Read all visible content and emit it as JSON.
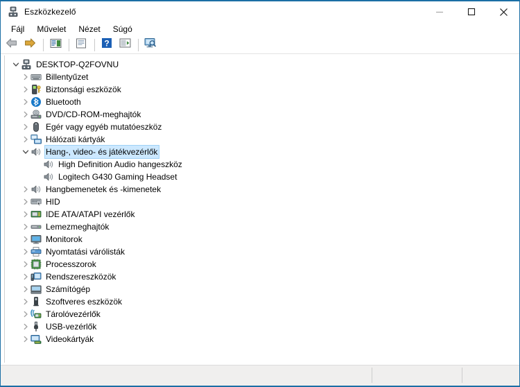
{
  "window": {
    "title": "Eszközkezelő",
    "app_icon": "device-manager-icon",
    "controls": {
      "minimize": "minimize-icon",
      "maximize": "maximize-icon",
      "close": "close-icon"
    }
  },
  "menubar": {
    "items": [
      {
        "label": "Fájl",
        "name": "menu-file"
      },
      {
        "label": "Művelet",
        "name": "menu-action"
      },
      {
        "label": "Nézet",
        "name": "menu-view"
      },
      {
        "label": "Súgó",
        "name": "menu-help"
      }
    ]
  },
  "toolbar": {
    "buttons": [
      {
        "name": "back-button",
        "icon": "left-arrow-icon"
      },
      {
        "name": "forward-button",
        "icon": "right-arrow-icon"
      },
      {
        "name": "properties-button",
        "icon": "properties-icon"
      },
      {
        "name": "update-driver-button",
        "icon": "document-icon"
      },
      {
        "name": "help-button",
        "icon": "question-mark-icon"
      },
      {
        "name": "scan-hardware-button",
        "icon": "scan-icon"
      },
      {
        "name": "show-hidden-devices-button",
        "icon": "monitor-search-icon"
      }
    ]
  },
  "tree": {
    "root": {
      "label": "DESKTOP-Q2FOVNU",
      "icon": "computer-icon",
      "expanded": true,
      "depth": 0
    },
    "nodes": [
      {
        "label": "Billentyűzet",
        "icon": "keyboard-icon",
        "depth": 1,
        "expanded": false,
        "selected": false
      },
      {
        "label": "Biztonsági eszközök",
        "icon": "security-device-icon",
        "depth": 1,
        "expanded": false,
        "selected": false
      },
      {
        "label": "Bluetooth",
        "icon": "bluetooth-icon",
        "depth": 1,
        "expanded": false,
        "selected": false
      },
      {
        "label": "DVD/CD-ROM-meghajtók",
        "icon": "dvd-drive-icon",
        "depth": 1,
        "expanded": false,
        "selected": false
      },
      {
        "label": "Egér vagy egyéb mutatóeszköz",
        "icon": "mouse-icon",
        "depth": 1,
        "expanded": false,
        "selected": false
      },
      {
        "label": "Hálózati kártyák",
        "icon": "network-adapter-icon",
        "depth": 1,
        "expanded": false,
        "selected": false
      },
      {
        "label": "Hang-, video- és játékvezérlők",
        "icon": "speaker-icon",
        "depth": 1,
        "expanded": true,
        "selected": true
      },
      {
        "label": "High Definition Audio hangeszköz",
        "icon": "speaker-icon",
        "depth": 2,
        "expanded": null,
        "selected": false
      },
      {
        "label": "Logitech G430 Gaming Headset",
        "icon": "speaker-icon",
        "depth": 2,
        "expanded": null,
        "selected": false
      },
      {
        "label": "Hangbemenetek és -kimenetek",
        "icon": "speaker-icon",
        "depth": 1,
        "expanded": false,
        "selected": false
      },
      {
        "label": "HID",
        "icon": "hid-icon",
        "depth": 1,
        "expanded": false,
        "selected": false
      },
      {
        "label": "IDE ATA/ATAPI vezérlők",
        "icon": "ide-controller-icon",
        "depth": 1,
        "expanded": false,
        "selected": false
      },
      {
        "label": "Lemezmeghajtók",
        "icon": "disk-drive-icon",
        "depth": 1,
        "expanded": false,
        "selected": false
      },
      {
        "label": "Monitorok",
        "icon": "monitor-icon",
        "depth": 1,
        "expanded": false,
        "selected": false
      },
      {
        "label": "Nyomtatási várólisták",
        "icon": "printer-icon",
        "depth": 1,
        "expanded": false,
        "selected": false
      },
      {
        "label": "Processzorok",
        "icon": "processor-icon",
        "depth": 1,
        "expanded": false,
        "selected": false
      },
      {
        "label": "Rendszereszközök",
        "icon": "system-device-icon",
        "depth": 1,
        "expanded": false,
        "selected": false
      },
      {
        "label": "Számítógép",
        "icon": "computer-display-icon",
        "depth": 1,
        "expanded": false,
        "selected": false
      },
      {
        "label": "Szoftveres eszközök",
        "icon": "software-device-icon",
        "depth": 1,
        "expanded": false,
        "selected": false
      },
      {
        "label": "Tárolóvezérlők",
        "icon": "storage-controller-icon",
        "depth": 1,
        "expanded": false,
        "selected": false
      },
      {
        "label": "USB-vezérlők",
        "icon": "usb-icon",
        "depth": 1,
        "expanded": false,
        "selected": false
      },
      {
        "label": "Videokártyák",
        "icon": "display-adapter-icon",
        "depth": 1,
        "expanded": false,
        "selected": false
      }
    ]
  },
  "statusbar": {
    "panels": [
      "",
      "",
      ""
    ]
  },
  "colors": {
    "frame_accent": "#1b6ea5",
    "selection": "#cce8ff",
    "statusbar_bg": "#f0efee"
  }
}
